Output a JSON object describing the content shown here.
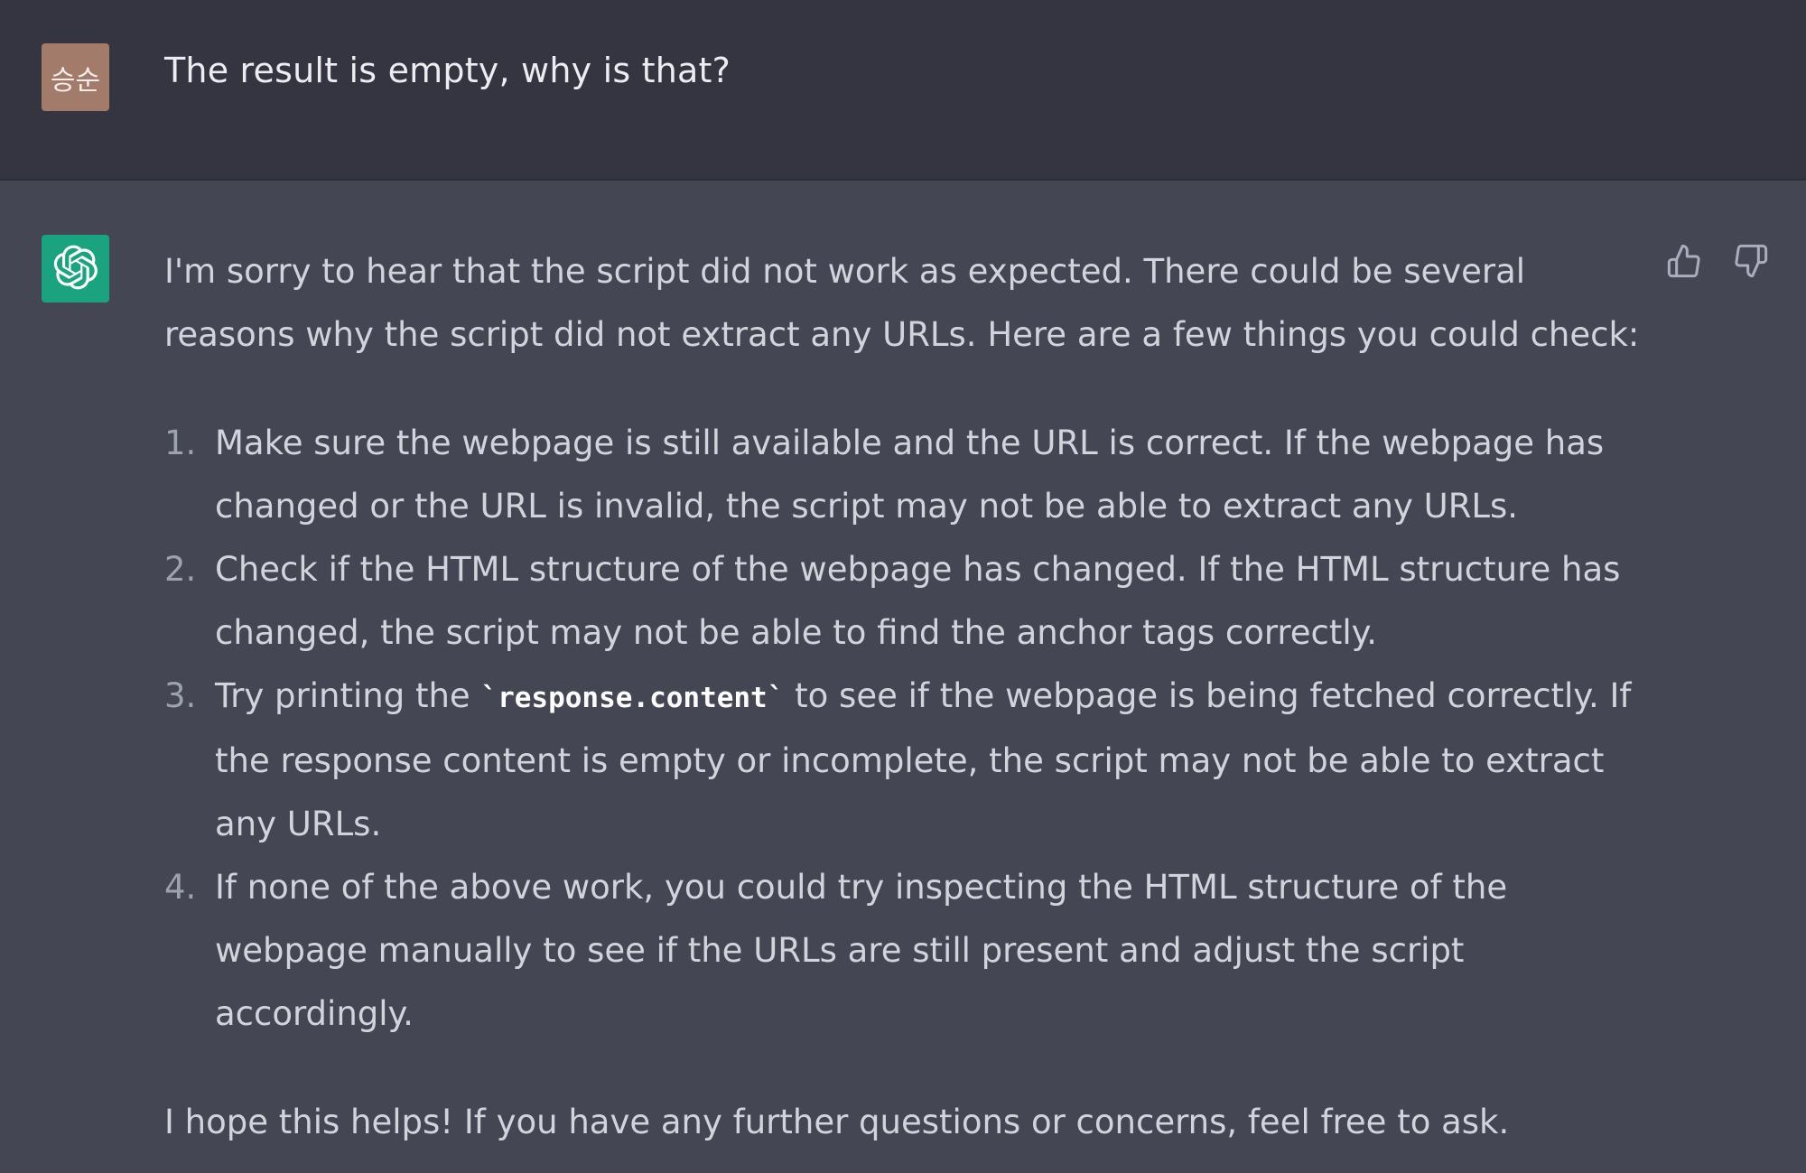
{
  "user": {
    "avatar_text": "승순",
    "message": "The result is empty, why is that?"
  },
  "assistant": {
    "avatar_icon": "openai-logo-icon",
    "intro": "I'm sorry to hear that the script did not work as expected. There could be several reasons why the script did not extract any URLs. Here are a few things you could check:",
    "items": [
      {
        "num": "1.",
        "text": "Make sure the webpage is still available and the URL is correct. If the webpage has changed or the URL is invalid, the script may not be able to extract any URLs."
      },
      {
        "num": "2.",
        "text": "Check if the HTML structure of the webpage has changed. If the HTML structure has changed, the script may not be able to find the anchor tags correctly."
      },
      {
        "num": "3.",
        "text_before": "Try printing the ",
        "code": "`response.content`",
        "text_after": " to see if the webpage is being fetched correctly. If the response content is empty or incomplete, the script may not be able to extract any URLs."
      },
      {
        "num": "4.",
        "text": "If none of the above work, you could try inspecting the HTML structure of the webpage manually to see if the URLs are still present and adjust the script accordingly."
      }
    ],
    "outro": "I hope this helps! If you have any further questions or concerns, feel free to ask."
  },
  "actions": {
    "thumbs_up_icon": "thumbs-up-icon",
    "thumbs_down_icon": "thumbs-down-icon"
  },
  "colors": {
    "user_bg": "#343541",
    "assistant_bg": "#444654",
    "user_avatar": "#a37b6a",
    "bot_avatar": "#19a37f",
    "text": "#d1d5db"
  }
}
